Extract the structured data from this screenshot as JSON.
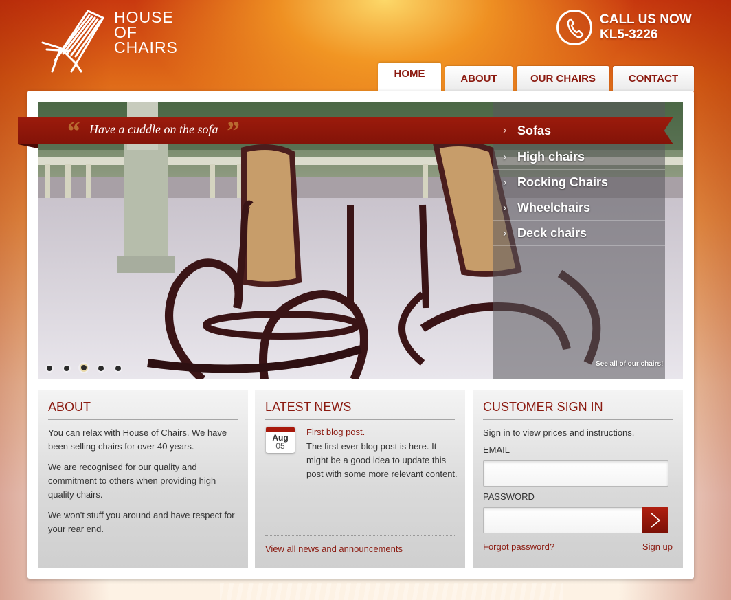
{
  "header": {
    "logo_lines": [
      "HOUSE",
      "OF",
      "CHAIRS"
    ],
    "call_line1": "CALL US NOW",
    "call_line2": "KL5-3226"
  },
  "nav": {
    "tabs": [
      {
        "label": "HOME",
        "active": true
      },
      {
        "label": "ABOUT"
      },
      {
        "label": "OUR CHAIRS"
      },
      {
        "label": "CONTACT"
      }
    ]
  },
  "slider": {
    "tagline": "Have a cuddle on the sofa",
    "quote_open": "“",
    "quote_close": "”",
    "categories": [
      "Sofas",
      "High chairs",
      "Rocking Chairs",
      "Wheelchairs",
      "Deck chairs"
    ],
    "chevron": "›",
    "see_all": "See all of our chairs!",
    "slide_count": 5,
    "active_slide": 3
  },
  "about": {
    "heading": "ABOUT",
    "paragraphs": [
      "You can relax with House of Chairs. We have been selling chairs for over 40 years.",
      "We are recognised for our quality and commitment to others when providing high quality chairs.",
      "We won't stuff you around and have respect for your rear end."
    ]
  },
  "news": {
    "heading": "LATEST NEWS",
    "date_month": "Aug",
    "date_day": "05",
    "post_title": "First blog post.",
    "post_body": "The first ever blog post is here. It might be a good idea to update this post with some more relevant content.",
    "view_all": "View all news and announcements"
  },
  "signin": {
    "heading": "CUSTOMER SIGN IN",
    "intro": "Sign in to view prices and instructions.",
    "email_label": "EMAIL",
    "email_value": "",
    "password_label": "PASSWORD",
    "password_value": "",
    "forgot": "Forgot password?",
    "signup": "Sign up"
  },
  "colors": {
    "accent": "#8b1a10",
    "ribbon": "#9c1b0c",
    "header_orange": "#df6a18"
  },
  "icons": {
    "logo": "deck-chair-icon",
    "phone": "phone-icon",
    "submit": "chevron-right-icon"
  }
}
